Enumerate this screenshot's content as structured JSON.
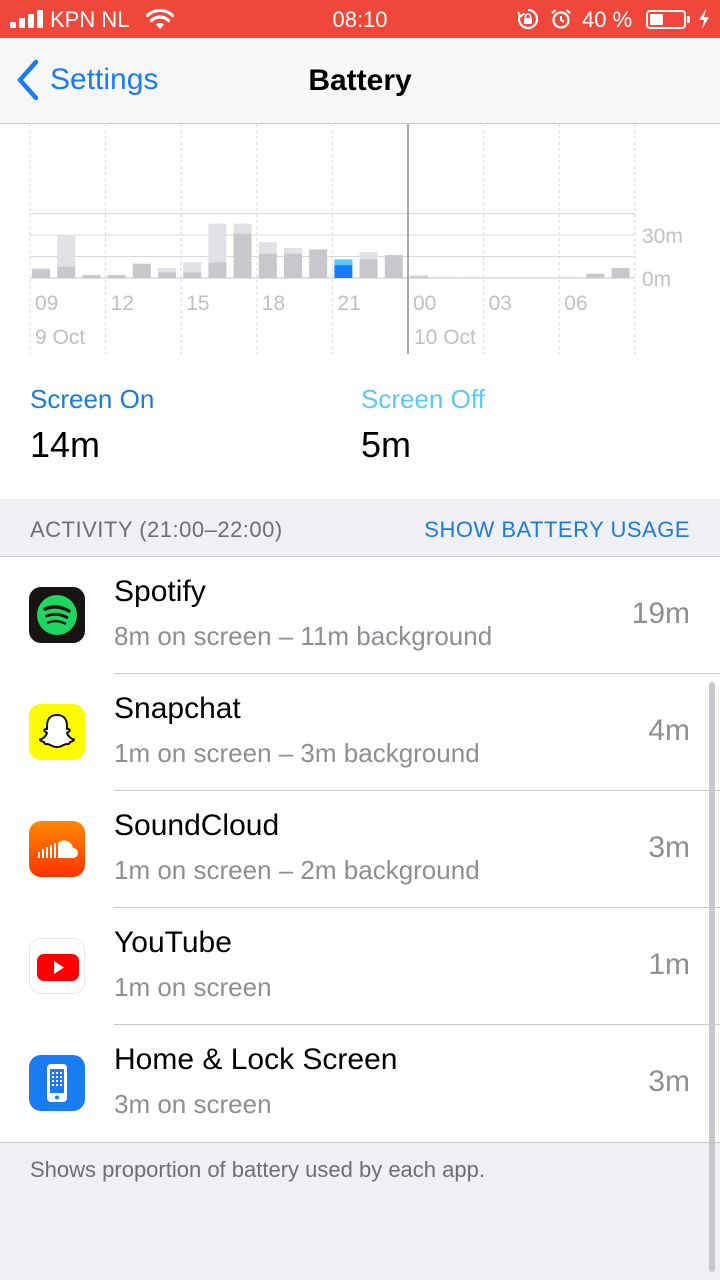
{
  "status_bar": {
    "carrier": "KPN NL",
    "time": "08:10",
    "battery_percent": "40 %",
    "battery_level": 0.4
  },
  "nav": {
    "back_label": "Settings",
    "title": "Battery"
  },
  "chart_data": {
    "type": "bar",
    "y_ticks": [
      "30m",
      "0m"
    ],
    "x_ticks": [
      "09",
      "12",
      "15",
      "18",
      "21",
      "00",
      "03",
      "06"
    ],
    "date_labels": [
      "9 Oct",
      "10 Oct"
    ],
    "bar_minutes": [
      {
        "total": 7,
        "screen_on": 6
      },
      {
        "total": 30,
        "screen_on": 8
      },
      {
        "total": 2,
        "screen_on": 2
      },
      {
        "total": 2,
        "screen_on": 2
      },
      {
        "total": 10,
        "screen_on": 10
      },
      {
        "total": 7,
        "screen_on": 4
      },
      {
        "total": 11,
        "screen_on": 4
      },
      {
        "total": 38,
        "screen_on": 11
      },
      {
        "total": 38,
        "screen_on": 31
      },
      {
        "total": 25,
        "screen_on": 17
      },
      {
        "total": 21,
        "screen_on": 17
      },
      {
        "total": 20,
        "screen_on": 20
      },
      {
        "total": 13,
        "screen_on": 9
      },
      {
        "total": 18,
        "screen_on": 13
      },
      {
        "total": 16,
        "screen_on": 16
      },
      {
        "total": 2,
        "screen_on": 1
      },
      {
        "total": 1,
        "screen_on": 0
      },
      {
        "total": 1,
        "screen_on": 0
      },
      {
        "total": 0,
        "screen_on": 0
      },
      {
        "total": 0,
        "screen_on": 0
      },
      {
        "total": 0,
        "screen_on": 0
      },
      {
        "total": 1,
        "screen_on": 0
      },
      {
        "total": 3,
        "screen_on": 3
      },
      {
        "total": 7,
        "screen_on": 7
      }
    ],
    "selected_index": 12,
    "colors": {
      "screen_on": "#c7c7cc",
      "screen_off": "#e1e1e6",
      "selected_on": "#1a7cf4",
      "selected_off": "#5ac8fa",
      "grid": "#d8d8dc",
      "label": "#c0c0c5"
    }
  },
  "summary": {
    "screen_on_label": "Screen On",
    "screen_on_value": "14m",
    "screen_off_label": "Screen Off",
    "screen_off_value": "5m"
  },
  "activity": {
    "header": "ACTIVITY (21:00–22:00)",
    "action": "SHOW BATTERY USAGE",
    "apps": [
      {
        "name": "Spotify",
        "detail": "8m on screen – 11m background",
        "value": "19m",
        "icon": "spotify-icon"
      },
      {
        "name": "Snapchat",
        "detail": "1m on screen – 3m background",
        "value": "4m",
        "icon": "snapchat-icon"
      },
      {
        "name": "SoundCloud",
        "detail": "1m on screen – 2m background",
        "value": "3m",
        "icon": "soundcloud-icon"
      },
      {
        "name": "YouTube",
        "detail": "1m on screen",
        "value": "1m",
        "icon": "youtube-icon"
      },
      {
        "name": "Home & Lock Screen",
        "detail": "3m on screen",
        "value": "3m",
        "icon": "home-lock-screen-icon"
      }
    ]
  },
  "footer_note": "Shows proportion of battery used by each app."
}
